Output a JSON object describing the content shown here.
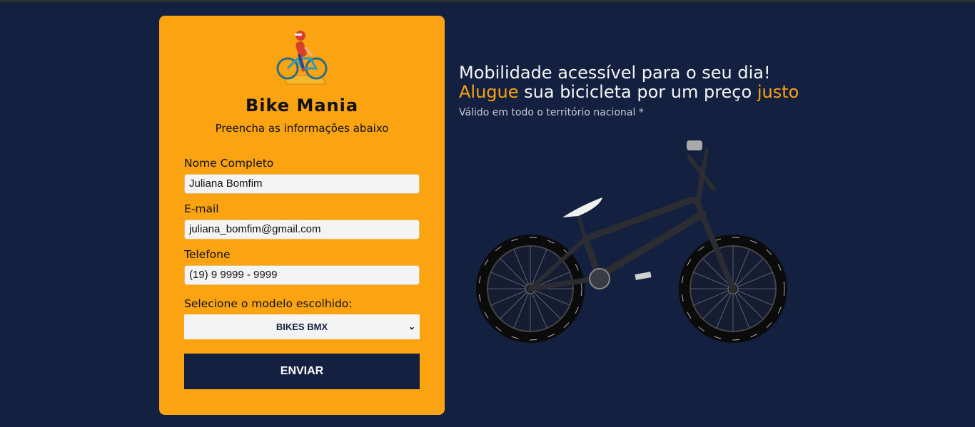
{
  "form": {
    "brand": "Bike Mania",
    "subtitle": "Preencha as informações abaixo",
    "fields": [
      {
        "label": "Nome Completo",
        "value": "Juliana Bomfim"
      },
      {
        "label": "E-mail",
        "value": "juliana_bomfim@gmail.com"
      },
      {
        "label": "Telefone",
        "value": "(19) 9 9999 - 9999"
      }
    ],
    "model_label": "Selecione o modelo escolhido:",
    "model_selected": "BIKES BMX",
    "submit_label": "ENVIAR"
  },
  "hero": {
    "line1": "Mobilidade acessível para o seu dia!",
    "line2_accent1": "Alugue",
    "line2_middle": " sua bicicleta por um preço ",
    "line2_accent2": "justo",
    "validity": "Válido em todo o território nacional *"
  },
  "colors": {
    "background": "#13203f",
    "accent": "#fba310",
    "input_bg": "#f4f4f5"
  },
  "icons": {
    "logo": "cyclist-logo-icon",
    "select": "chevron-down-icon"
  }
}
